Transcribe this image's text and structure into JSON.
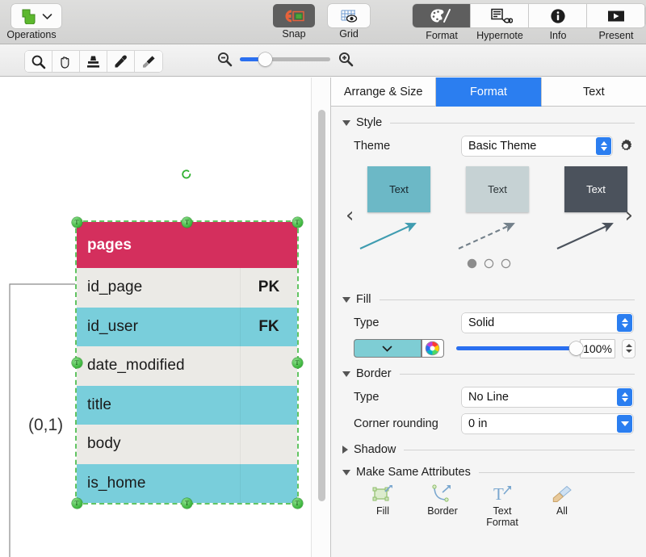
{
  "toolbar": {
    "operations": {
      "label": "Operations",
      "icon": "shape-operations-icon",
      "chevron": "chevron-down-icon"
    },
    "snap": {
      "label": "Snap",
      "icon": "snap-magnet-icon",
      "active": true
    },
    "grid": {
      "label": "Grid",
      "icon": "grid-eye-icon",
      "active": false
    },
    "segments": [
      {
        "label": "Format",
        "icon": "palette-icon",
        "active": true
      },
      {
        "label": "Hypernote",
        "icon": "hypernote-link-icon",
        "active": false
      },
      {
        "label": "Info",
        "icon": "info-circle-icon",
        "active": false
      },
      {
        "label": "Present",
        "icon": "present-play-icon",
        "active": false
      }
    ]
  },
  "tools": {
    "items": [
      {
        "name": "zoom-tool",
        "icon": "magnifier-icon"
      },
      {
        "name": "pan-tool",
        "icon": "hand-icon"
      },
      {
        "name": "stamp-tool",
        "icon": "stamp-icon"
      },
      {
        "name": "eyedropper-tool",
        "icon": "eyedropper-icon"
      },
      {
        "name": "brush-tool",
        "icon": "paintbrush-icon"
      }
    ],
    "zoom_out_icon": "zoom-out-icon",
    "zoom_in_icon": "zoom-in-icon",
    "zoom_percent": 28
  },
  "canvas": {
    "table": {
      "title": "pages",
      "header_color": "#d42f5d",
      "rows": [
        {
          "name": "id_page",
          "key": "PK",
          "fill": "#ebeae6"
        },
        {
          "name": "id_user",
          "key": "FK",
          "fill": "#79cedb"
        },
        {
          "name": "date_modified",
          "key": "",
          "fill": "#ebeae6"
        },
        {
          "name": "title",
          "key": "",
          "fill": "#79cedb"
        },
        {
          "name": "body",
          "key": "",
          "fill": "#ebeae6"
        },
        {
          "name": "is_home",
          "key": "",
          "fill": "#79cedb"
        }
      ],
      "selected": true,
      "handle_glyph": "T"
    },
    "cardinality_label": "(0,1)",
    "rotate_handle_icon": "rotate-handle-icon",
    "scrollbar": "vertical-scrollbar"
  },
  "panel": {
    "tabs": [
      {
        "label": "Arrange & Size",
        "active": false
      },
      {
        "label": "Format",
        "active": true
      },
      {
        "label": "Text",
        "active": false
      }
    ],
    "style": {
      "title": "Style",
      "expanded": true,
      "theme_label": "Theme",
      "theme_value": "Basic Theme",
      "gear_icon": "gear-icon",
      "prev_icon": "chevron-left-icon",
      "next_icon": "chevron-right-icon",
      "thumbs": [
        {
          "text": "Text",
          "fill": "#6cb8c6",
          "text_color": "#16242b",
          "arrow_color": "#3f9cb0",
          "arrow_style": "solid"
        },
        {
          "text": "Text",
          "fill": "#c6d2d4",
          "text_color": "#2b3336",
          "arrow_color": "#73808a",
          "arrow_style": "dashed"
        },
        {
          "text": "Text",
          "fill": "#4b525c",
          "text_color": "#ffffff",
          "arrow_color": "#4b525c",
          "arrow_style": "solid"
        }
      ],
      "page_dots": 3,
      "active_dot": 0
    },
    "fill": {
      "title": "Fill",
      "expanded": true,
      "type_label": "Type",
      "type_value": "Solid",
      "swatch_color": "#7ecdd4",
      "swatch_chevron": "chevron-down-icon",
      "color_wheel_icon": "color-wheel-icon",
      "opacity_value": "100%",
      "opacity_percent": 100
    },
    "border": {
      "title": "Border",
      "expanded": true,
      "type_label": "Type",
      "type_value": "No Line",
      "corner_label": "Corner rounding",
      "corner_value": "0 in"
    },
    "shadow": {
      "title": "Shadow",
      "expanded": false
    },
    "make_same": {
      "title": "Make Same Attributes",
      "expanded": true,
      "items": [
        {
          "label": "Fill",
          "icon": "same-fill-icon"
        },
        {
          "label": "Border",
          "icon": "same-border-icon"
        },
        {
          "label": "Text\nFormat",
          "icon": "same-text-format-icon"
        },
        {
          "label": "All",
          "icon": "same-all-icon"
        }
      ]
    }
  }
}
